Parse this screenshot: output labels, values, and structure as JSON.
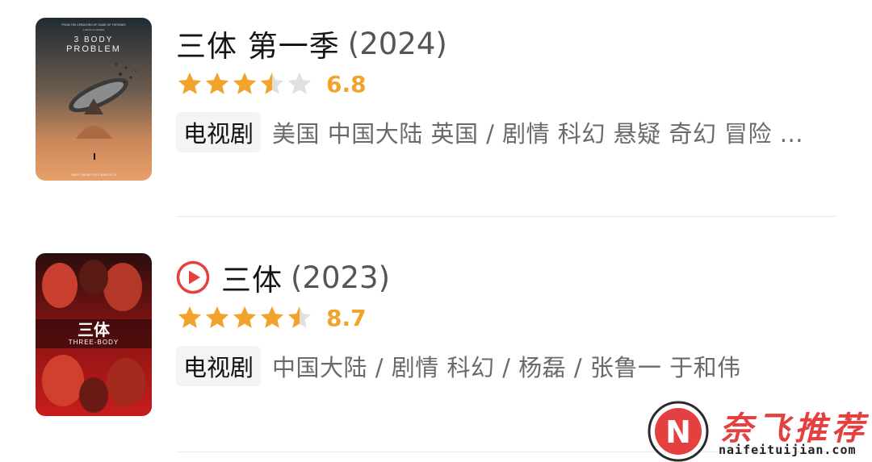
{
  "results": [
    {
      "title": "三体 第一季",
      "year": "(2024)",
      "has_play": false,
      "stars": [
        "full",
        "full",
        "full",
        "half",
        "empty"
      ],
      "score": "6.8",
      "type": "电视剧",
      "meta": "美国 中国大陆 英国 / 剧情 科幻 悬疑 奇幻 冒险 ...",
      "poster": {
        "top_tagline": "FROM THE CREATORS OF GAME OF THRONES",
        "subline": "A NETFLIX SERIES",
        "title_line1": "3 BODY",
        "title_line2": "PROBLEM",
        "footer": "ONLY ON NETFLIX MARCH 21"
      }
    },
    {
      "title": "三体",
      "year": "(2023)",
      "has_play": true,
      "stars": [
        "full",
        "full",
        "full",
        "full",
        "half"
      ],
      "score": "8.7",
      "type": "电视剧",
      "meta": "中国大陆 / 剧情 科幻 / 杨磊 / 张鲁一 于和伟",
      "poster": {
        "title_cn": "三体",
        "title_en": "THREE-BODY"
      }
    }
  ],
  "watermark": {
    "logo_letter": "N",
    "name": "奈飞推荐",
    "domain": "naifeituijian.com"
  },
  "colors": {
    "star": "#f2a32b",
    "star_empty": "#e0e0e0",
    "play": "#e4403f",
    "brand": "#e4403f"
  },
  "icons": {
    "star_full": "star-full-icon",
    "star_half": "star-half-icon",
    "star_empty": "star-empty-icon",
    "play": "play-circle-icon"
  }
}
